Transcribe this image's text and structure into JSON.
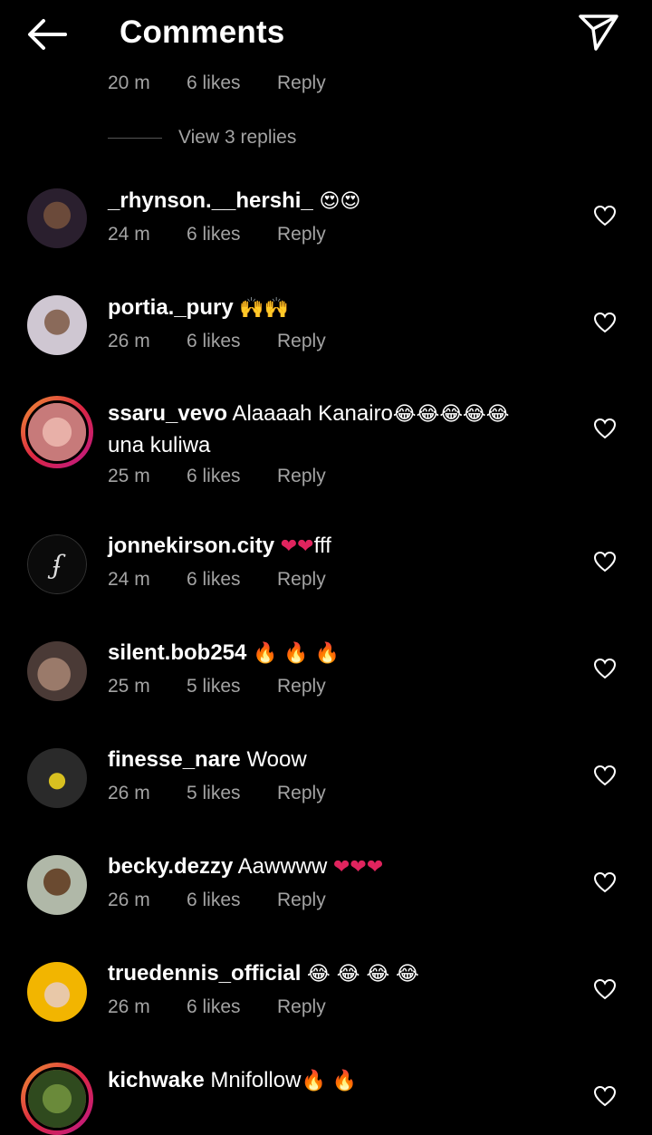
{
  "header": {
    "title": "Comments",
    "back_icon": "back-arrow-icon",
    "send_icon": "send-icon"
  },
  "partial_top": {
    "time": "20 m",
    "likes": "6 likes",
    "reply": "Reply"
  },
  "view_replies": "View 3 replies",
  "comments": [
    {
      "user": "_rhynson.__hershi_",
      "text": "",
      "emoji": "😍😍",
      "time": "24 m",
      "likes": "6 likes",
      "reply": "Reply"
    },
    {
      "user": "portia._pury",
      "text": "",
      "emoji": "🙌🙌",
      "time": "26 m",
      "likes": "6 likes",
      "reply": "Reply"
    },
    {
      "user": "ssaru_vevo",
      "text": "Alaaaah  Kanairo",
      "emoji": "😂😂😂😂😂",
      "text2": "una kuliwa",
      "time": "25 m",
      "likes": "6 likes",
      "reply": "Reply"
    },
    {
      "user": "jonnekirson.city",
      "text": "",
      "emoji": "❤❤",
      "text_after": "fff",
      "time": "24 m",
      "likes": "6 likes",
      "reply": "Reply"
    },
    {
      "user": "silent.bob254",
      "text": "",
      "emoji": "🔥 🔥 🔥",
      "time": "25 m",
      "likes": "5 likes",
      "reply": "Reply"
    },
    {
      "user": "finesse_nare",
      "text": "Woow",
      "emoji": "",
      "time": "26 m",
      "likes": "5 likes",
      "reply": "Reply"
    },
    {
      "user": "becky.dezzy",
      "text": "Aawwww",
      "emoji": "❤❤❤",
      "time": "26 m",
      "likes": "6 likes",
      "reply": "Reply"
    },
    {
      "user": "truedennis_official",
      "text": "",
      "emoji": "😂 😂 😂 😂",
      "time": "26 m",
      "likes": "6 likes",
      "reply": "Reply"
    },
    {
      "user": "kichwake",
      "text": "Mnifollow",
      "emoji": "🔥 🔥",
      "time": "",
      "likes": "",
      "reply": ""
    }
  ],
  "colors": {
    "background": "#000000",
    "text": "#ffffff",
    "meta": "#a3a3a3",
    "heart_emoji": "#e0245e"
  }
}
